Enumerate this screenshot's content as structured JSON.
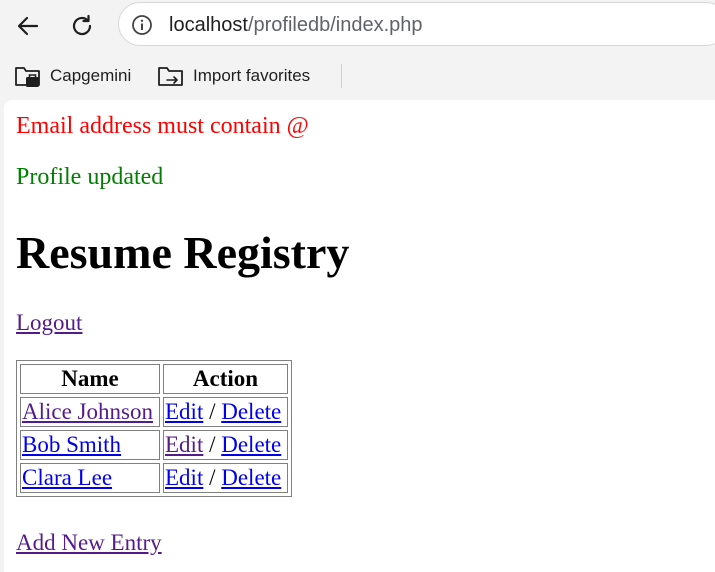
{
  "browser": {
    "url_host": "localhost",
    "url_path": "/profiledb/index.php",
    "bookmarks": [
      {
        "label": "Capgemini",
        "icon": "folder-icon"
      },
      {
        "label": "Import favorites",
        "icon": "import-folder-icon"
      }
    ]
  },
  "page": {
    "error_message": "Email address must contain @",
    "success_message": "Profile updated",
    "title": "Resume Registry",
    "logout_label": "Logout",
    "table": {
      "headers": [
        "Name",
        "Action"
      ],
      "rows": [
        {
          "name": "Alice Johnson",
          "edit": "Edit",
          "sep": "/",
          "delete": "Delete"
        },
        {
          "name": "Bob Smith",
          "edit": "Edit",
          "sep": "/",
          "delete": "Delete"
        },
        {
          "name": "Clara Lee",
          "edit": "Edit",
          "sep": "/",
          "delete": "Delete"
        }
      ]
    },
    "add_new_label": "Add New Entry"
  },
  "colors": {
    "error": "#ff0000",
    "success": "#008000",
    "link": "#0000ee",
    "visited_link": "#551a8b"
  }
}
